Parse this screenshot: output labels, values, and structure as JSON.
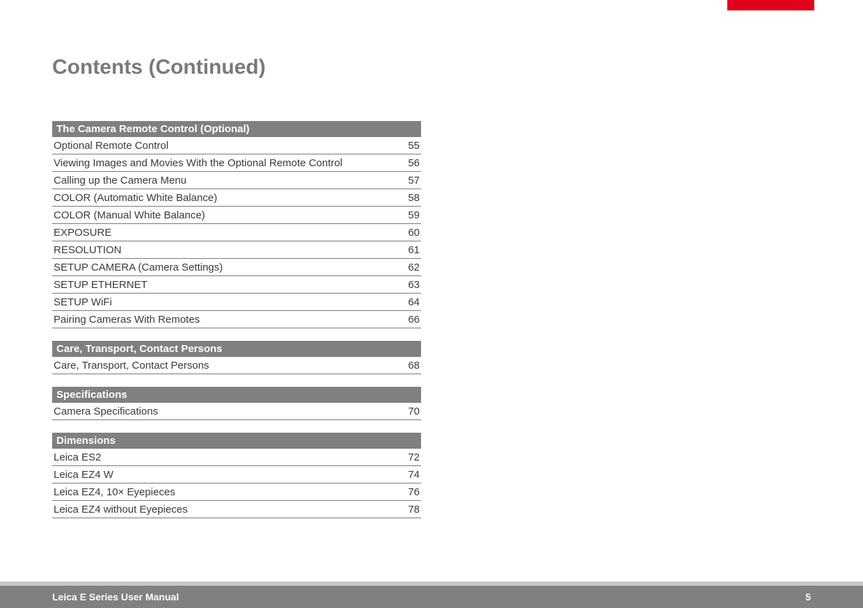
{
  "colors": {
    "accent_red": "#e2001a",
    "header_gray": "#808080",
    "title_gray": "#7a7a7a",
    "text": "#3a3a3a"
  },
  "title": "Contents (Continued)",
  "sections": [
    {
      "heading": "The Camera Remote Control (Optional)",
      "entries": [
        {
          "label": "Optional Remote Control",
          "page": "55"
        },
        {
          "label": "Viewing Images and Movies With the Optional Remote Control",
          "page": "56"
        },
        {
          "label": "Calling up the Camera Menu",
          "page": "57"
        },
        {
          "label": "COLOR (Automatic White Balance)",
          "page": "58"
        },
        {
          "label": "COLOR (Manual White Balance)",
          "page": "59"
        },
        {
          "label": "EXPOSURE",
          "page": "60"
        },
        {
          "label": "RESOLUTION",
          "page": "61"
        },
        {
          "label": "SETUP CAMERA (Camera Settings)",
          "page": "62"
        },
        {
          "label": "SETUP ETHERNET",
          "page": "63"
        },
        {
          "label": "SETUP WiFi",
          "page": "64"
        },
        {
          "label": "Pairing Cameras With Remotes",
          "page": "66"
        }
      ]
    },
    {
      "heading": "Care, Transport, Contact Persons",
      "entries": [
        {
          "label": "Care, Transport, Contact Persons",
          "page": "68"
        }
      ]
    },
    {
      "heading": "Specifications",
      "entries": [
        {
          "label": "Camera Specifications",
          "page": "70"
        }
      ]
    },
    {
      "heading": "Dimensions",
      "entries": [
        {
          "label": "Leica ES2",
          "page": "72"
        },
        {
          "label": "Leica EZ4 W",
          "page": "74"
        },
        {
          "label": "Leica EZ4, 10× Eyepieces",
          "page": "76"
        },
        {
          "label": "Leica EZ4 without Eyepieces",
          "page": "78"
        }
      ]
    }
  ],
  "footer": {
    "doc_title": "Leica E Series User Manual",
    "page_number": "5"
  }
}
